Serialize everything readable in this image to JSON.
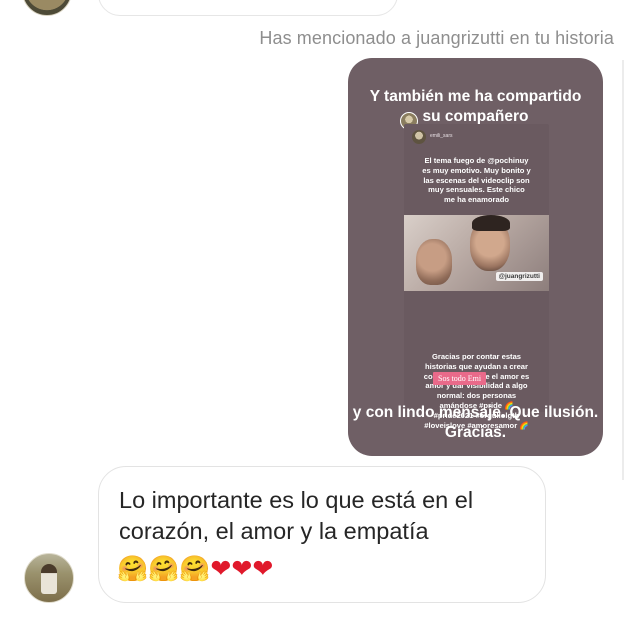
{
  "mention_note": "Has mencionado a juangrizutti en tu historia",
  "story": {
    "title_line1": "Y también me ha compartido",
    "title_line2": "su compañero",
    "inner_user": "emili_sars",
    "inner_top_text": "El tema fuego de @pochinuy\nes muy emotivo. Muy bonito y\nlas escenas del videoclip son\nmuy sensuales. Este chico\nme ha enamorado",
    "photo_mention": "@juangrizutti",
    "inner_bottom_text": "Gracias por contar estas\nhistorias que ayudan a crear\nconciencia de que el amor es\namor y dar visibilidad a algo\nnormal: dos personas\namándose #pride 🌈\n#pride2021 #orgullolgtb\n#loveislove #amoresamor 🌈",
    "sticker": "Sos todo Emi",
    "caption": "y con lindo mensaje. Que ilusión.  Gracias."
  },
  "reply": {
    "text": "Lo importante es lo que está en el corazón, el amor y la empatía",
    "emojis": [
      "hugging-face",
      "hugging-face",
      "hugging-face",
      "red-heart",
      "red-heart",
      "red-heart"
    ]
  },
  "colors": {
    "story_bg": "#6f5f65",
    "meta_text": "#8e8e8e",
    "heart": "#e0192b",
    "sticker_bg": "#e96a8a"
  }
}
